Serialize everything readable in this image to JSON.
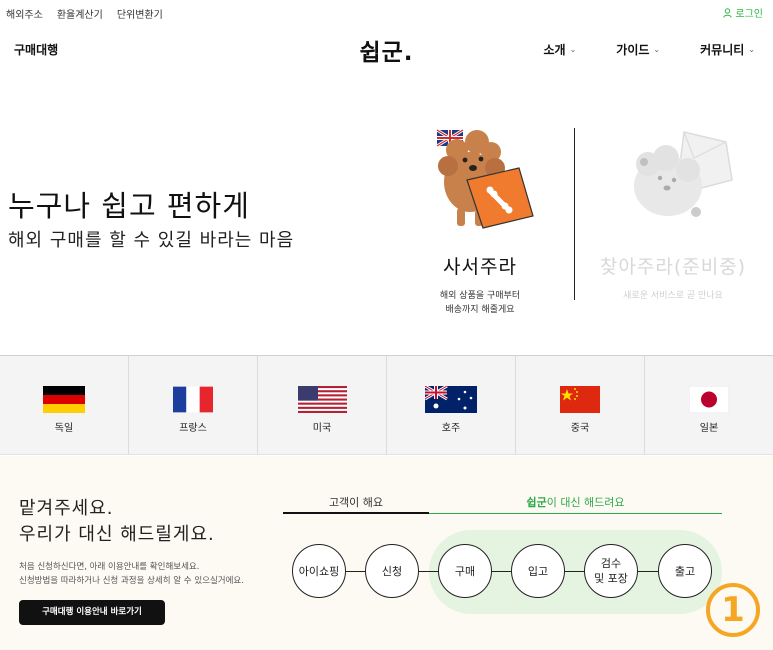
{
  "util": {
    "links": [
      "해외주소",
      "환율계산기",
      "단위변환기"
    ],
    "login": "로그인"
  },
  "header": {
    "left_label": "구매대행",
    "logo": "쉽군.",
    "nav": [
      "소개",
      "가이드",
      "커뮤니티"
    ]
  },
  "hero": {
    "title": "누구나 쉽고 편하게",
    "subtitle": "해외 구매를 할 수 있길 바라는 마음"
  },
  "services": [
    {
      "name": "사서주라",
      "desc_line1": "해외 상품을 구매부터",
      "desc_line2": "배송까지 해줄게요"
    },
    {
      "name": "찾아주라(준비중)",
      "desc_line1": "새로운 서비스로 곧 만나요",
      "desc_line2": ""
    }
  ],
  "countries": [
    "독일",
    "프랑스",
    "미국",
    "호주",
    "중국",
    "일본"
  ],
  "bottom": {
    "title_line1": "맡겨주세요.",
    "title_line2": "우리가 대신 해드릴게요.",
    "desc_line1": "처음 신청하신다면, 아래 이용안내를 확인해보세요.",
    "desc_line2": "신청방법을 따라하거나 신청 과정을 상세히 알 수 있으실거에요.",
    "button": "구매대행 이용안내 바로가기",
    "tab_customer": "고객이 해요",
    "tab_ours_brand": "쉽군",
    "tab_ours_rest": "이 대신 해드려요",
    "steps": [
      "아이쇼핑",
      "신청",
      "구매",
      "입고",
      "검수\n및 포장",
      "출고"
    ]
  },
  "badge": "1",
  "colors": {
    "accent_green": "#2fa84a",
    "badge_orange": "#f5a623",
    "dog_brown": "#c8814b",
    "pillow_orange": "#f07a2d"
  }
}
